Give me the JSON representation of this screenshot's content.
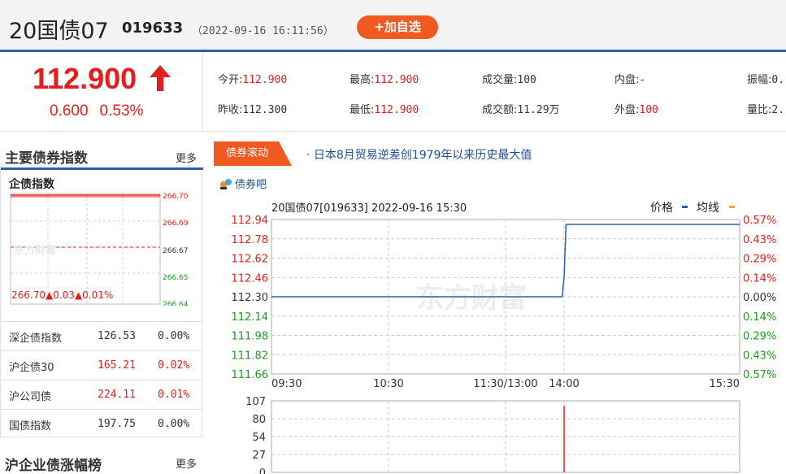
{
  "header": {
    "bond_name": "20国债07",
    "bond_code": "019633",
    "timestamp": "（2022-09-16 16:11:56）",
    "add_watchlist": "+加自选"
  },
  "quote": {
    "price": "112.900",
    "change": "0.600",
    "change_pct": "0.53%",
    "fields": [
      {
        "label": "今开:",
        "value": "112.900",
        "color": "red"
      },
      {
        "label": "最高:",
        "value": "112.900",
        "color": "red"
      },
      {
        "label": "成交量:",
        "value": "100",
        "color": "normal"
      },
      {
        "label": "内盘:",
        "value": "-",
        "color": "normal"
      },
      {
        "label": "振幅:",
        "value": "0.",
        "color": "normal"
      },
      {
        "label": "昨收:",
        "value": "112.300",
        "color": "normal"
      },
      {
        "label": "最低:",
        "value": "112.900",
        "color": "red"
      },
      {
        "label": "成交额:",
        "value": "11.29万",
        "color": "normal"
      },
      {
        "label": "外盘:",
        "value": "100",
        "color": "red"
      },
      {
        "label": "量比:",
        "value": "2.",
        "color": "normal"
      }
    ]
  },
  "bond_index": {
    "section_title": "主要债券指数",
    "more": "更多",
    "tab": "企债指数",
    "mini_chart": {
      "y_ticks": [
        "266.70",
        "266.69",
        "266.67",
        "266.65",
        "266.64"
      ],
      "summary": "266.70▲0.03▲0.01%"
    },
    "rows": [
      {
        "name": "深企债指数",
        "price": "126.53",
        "pct": "0.00%",
        "color": "normal"
      },
      {
        "name": "沪企债30",
        "price": "165.21",
        "pct": "0.02%",
        "color": "red"
      },
      {
        "name": "沪公司债",
        "price": "224.11",
        "pct": "0.01%",
        "color": "red"
      },
      {
        "name": "国债指数",
        "price": "197.75",
        "pct": "0.00%",
        "color": "normal"
      }
    ]
  },
  "ranking": {
    "section_title": "沪企业债涨幅榜",
    "more": "更多"
  },
  "news": {
    "tag": "债券滚动",
    "headline": "· 日本8月贸易逆差创1979年以来历史最大值"
  },
  "bbs_link": "债券吧",
  "watermark": "东方财富",
  "chart_data": {
    "type": "line",
    "title": "20国债07[019633] 2022-09-16 15:30",
    "legend": [
      {
        "name": "价格",
        "color": "#2a62ad"
      },
      {
        "name": "均线",
        "color": "#f5a623"
      }
    ],
    "prev_close": 112.3,
    "y_ticks_left": [
      "112.94",
      "112.78",
      "112.62",
      "112.46",
      "112.30",
      "112.14",
      "111.98",
      "111.82",
      "111.66"
    ],
    "y_ticks_right": [
      "0.57%",
      "0.43%",
      "0.29%",
      "0.14%",
      "0.00%",
      "0.14%",
      "0.29%",
      "0.43%",
      "0.57%"
    ],
    "ylim": [
      111.66,
      112.94
    ],
    "x_ticks": [
      "09:30",
      "10:30",
      "11:30/13:00",
      "14:00",
      "15:30"
    ],
    "x_minutes": [
      0,
      60,
      120,
      150,
      240
    ],
    "price_series": [
      {
        "x": 0,
        "y": 112.3
      },
      {
        "x": 149,
        "y": 112.3
      },
      {
        "x": 150,
        "y": 112.46
      },
      {
        "x": 151,
        "y": 112.9
      },
      {
        "x": 240,
        "y": 112.9
      }
    ],
    "volume": {
      "y_ticks": [
        "107",
        "80",
        "54",
        "27",
        "0"
      ],
      "ylim": [
        0,
        107
      ],
      "bars": [
        {
          "x": 150,
          "value": 100
        }
      ]
    },
    "colors": {
      "up": "#e41e1e",
      "down": "#1a9d1a",
      "price_line": "#2a62ad",
      "volume_bar": "#e41e1e"
    }
  }
}
